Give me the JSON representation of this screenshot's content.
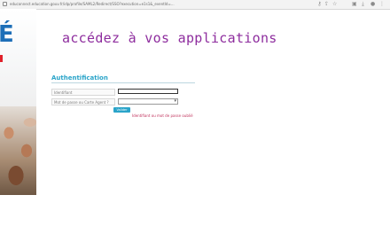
{
  "browser": {
    "url": "educonnect.education.gouv.fr/idp/profile/SAML2/Redirect/SSO?execution=e1s1&_eventId=..."
  },
  "header": {
    "title": "accédez à vos applications"
  },
  "auth": {
    "title": "Authentification",
    "username_label": "Identifiant",
    "select_label": "Mot de passe ou Carte Agent ?",
    "submit_label": "Valider",
    "help_link": "Identifiant ou mot de passe oublié"
  },
  "colors": {
    "title": "#8e2d9e",
    "accent": "#2aa4c9",
    "link": "#c0325c"
  }
}
